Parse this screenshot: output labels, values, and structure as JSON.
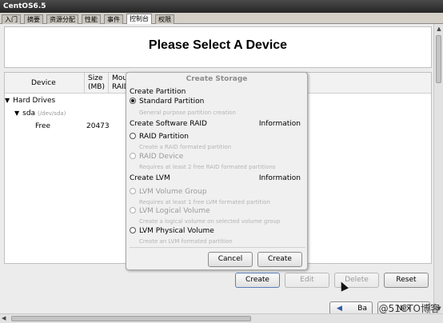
{
  "window": {
    "title": "CentOS6.5"
  },
  "tabs": [
    {
      "label": "入门"
    },
    {
      "label": "摘要"
    },
    {
      "label": "资源分配"
    },
    {
      "label": "性能"
    },
    {
      "label": "事件"
    },
    {
      "label": "控制台"
    },
    {
      "label": "权限"
    }
  ],
  "header": {
    "title": "Please Select A Device"
  },
  "table": {
    "columns": [
      {
        "label": "Device"
      },
      {
        "label": "Size",
        "label2": "(MB)"
      },
      {
        "label": "Mou",
        "label2": "RAID"
      }
    ],
    "rows": {
      "group": "Hard Drives",
      "disk": "sda",
      "disk_path": "(/dev/sda)",
      "free_label": "Free",
      "free_size": "20473"
    }
  },
  "dialog": {
    "title": "Create Storage",
    "info_label": "Information",
    "sections": {
      "partition": "Create Partition",
      "raid": "Create Software RAID",
      "lvm": "Create LVM"
    },
    "options": {
      "standard": {
        "label": "Standard Partition",
        "desc": "General purpose partition creation",
        "checked": true,
        "enabled": true
      },
      "raid_partition": {
        "label": "RAID Partition",
        "desc": "Create a RAID formated partition",
        "checked": false,
        "enabled": true
      },
      "raid_device": {
        "label": "RAID Device",
        "desc": "Requires at least 2 free RAID formated partitions",
        "checked": false,
        "enabled": false
      },
      "lvm_vg": {
        "label": "LVM Volume Group",
        "desc": "Requires at least 1 free LVM formated partition",
        "checked": false,
        "enabled": false
      },
      "lvm_lv": {
        "label": "LVM Logical Volume",
        "desc": "Create a logical volume on selected volume group",
        "checked": false,
        "enabled": false
      },
      "lvm_pv": {
        "label": "LVM Physical Volume",
        "desc": "Create an LVM formated partition",
        "checked": false,
        "enabled": true
      }
    },
    "buttons": {
      "cancel": "Cancel",
      "create": "Create"
    }
  },
  "actions": {
    "create": "Create",
    "edit": "Edit",
    "delete": "Delete",
    "reset": "Reset",
    "back": "Ba",
    "next": "Nex"
  },
  "watermark": "@51CTO博客"
}
